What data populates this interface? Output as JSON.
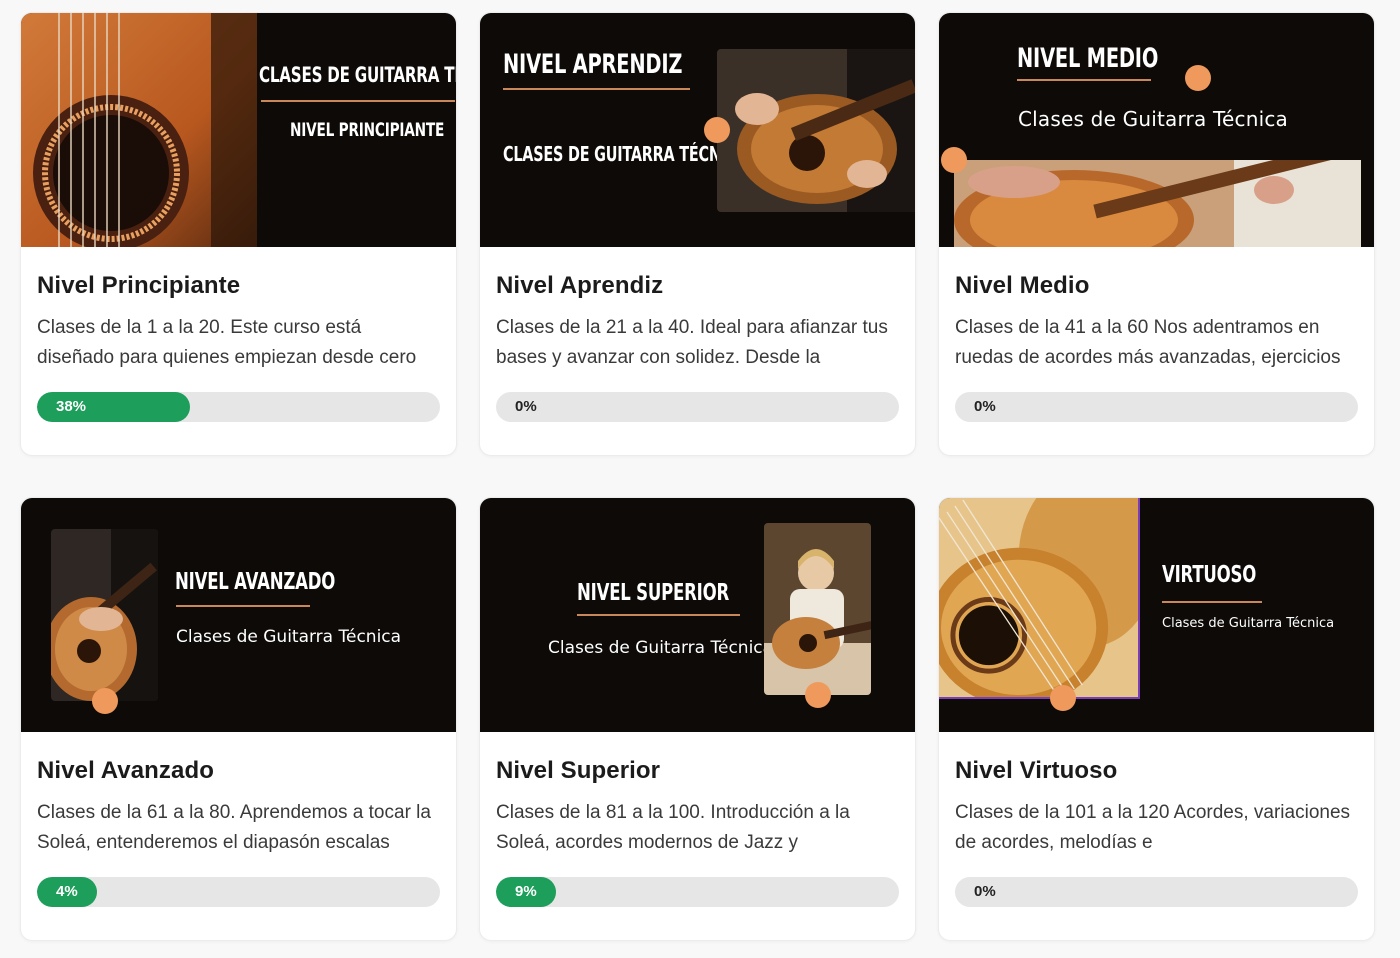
{
  "courses": [
    {
      "title": "Nivel Principiante",
      "description": "Clases de la 1 a la 20. Este curso está diseñado para quienes empiezan desde cero",
      "progress_label": "38%",
      "progress": 0.38,
      "banner": {
        "line1": "CLASES DE GUITARRA TÉCNICA",
        "line2": "NIVEL PRINCIPIANTE"
      }
    },
    {
      "title": "Nivel Aprendiz",
      "description": "Clases de la 21 a la 40. Ideal para afianzar tus bases y avanzar con solidez. Desde la",
      "progress_label": "0%",
      "progress": 0,
      "banner": {
        "line1": "NIVEL APRENDIZ",
        "line2": "CLASES DE GUITARRA  TÉCNICA"
      }
    },
    {
      "title": "Nivel Medio",
      "description": "Clases de la 41 a la 60 Nos adentramos en ruedas de acordes más avanzadas, ejercicios",
      "progress_label": "0%",
      "progress": 0,
      "banner": {
        "line1": "NIVEL MEDIO",
        "line2": "Clases de Guitarra Técnica"
      }
    },
    {
      "title": "Nivel Avanzado",
      "description": "Clases de la 61 a la 80. Aprendemos a tocar la Soleá, entenderemos el diapasón escalas",
      "progress_label": "4%",
      "progress": 0.04,
      "banner": {
        "line1": "NIVEL AVANZADO",
        "line2": "Clases de Guitarra Técnica"
      }
    },
    {
      "title": "Nivel Superior",
      "description": "Clases de la 81 a la 100. Introducción a la Soleá, acordes modernos de Jazz y",
      "progress_label": "9%",
      "progress": 0.09,
      "banner": {
        "line1": "NIVEL SUPERIOR",
        "line2": "Clases de Guitarra Técnica"
      }
    },
    {
      "title": "Nivel Virtuoso",
      "description": "Clases de la 101 a la 120 Acordes, variaciones de acordes, melodías e",
      "progress_label": "0%",
      "progress": 0,
      "banner": {
        "line1": "VIRTUOSO",
        "line2": "Clases de Guitarra Técnica"
      }
    }
  ],
  "colors": {
    "accent_dot": "#ef9a5c",
    "progress_fill": "#1d9e5a",
    "banner_bg": "#0d0a08",
    "rule": "#c9875a"
  }
}
